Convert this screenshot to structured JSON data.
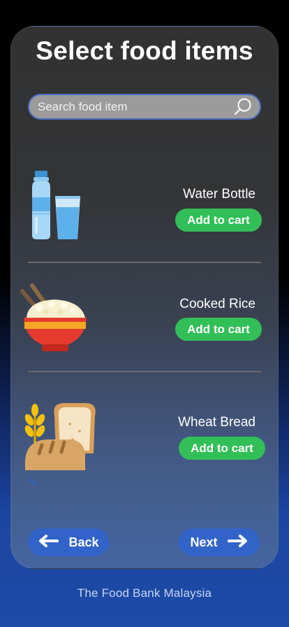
{
  "header": {
    "title": "Select food items"
  },
  "search": {
    "placeholder": "Search food item",
    "icon": "search-icon"
  },
  "items": [
    {
      "name": "Water Bottle",
      "button_label": "Add to cart",
      "icon": "water-bottle-icon"
    },
    {
      "name": "Cooked Rice",
      "button_label": "Add to cart",
      "icon": "rice-bowl-icon"
    },
    {
      "name": "Wheat Bread",
      "button_label": "Add to cart",
      "icon": "bread-icon"
    }
  ],
  "nav": {
    "back_label": "Back",
    "next_label": "Next"
  },
  "footer": {
    "text": "The Food Bank Malaysia"
  },
  "colors": {
    "accent_green": "#32bf57",
    "accent_blue": "#3263c8",
    "card_top": "#323232",
    "card_bottom": "#4565a0"
  }
}
